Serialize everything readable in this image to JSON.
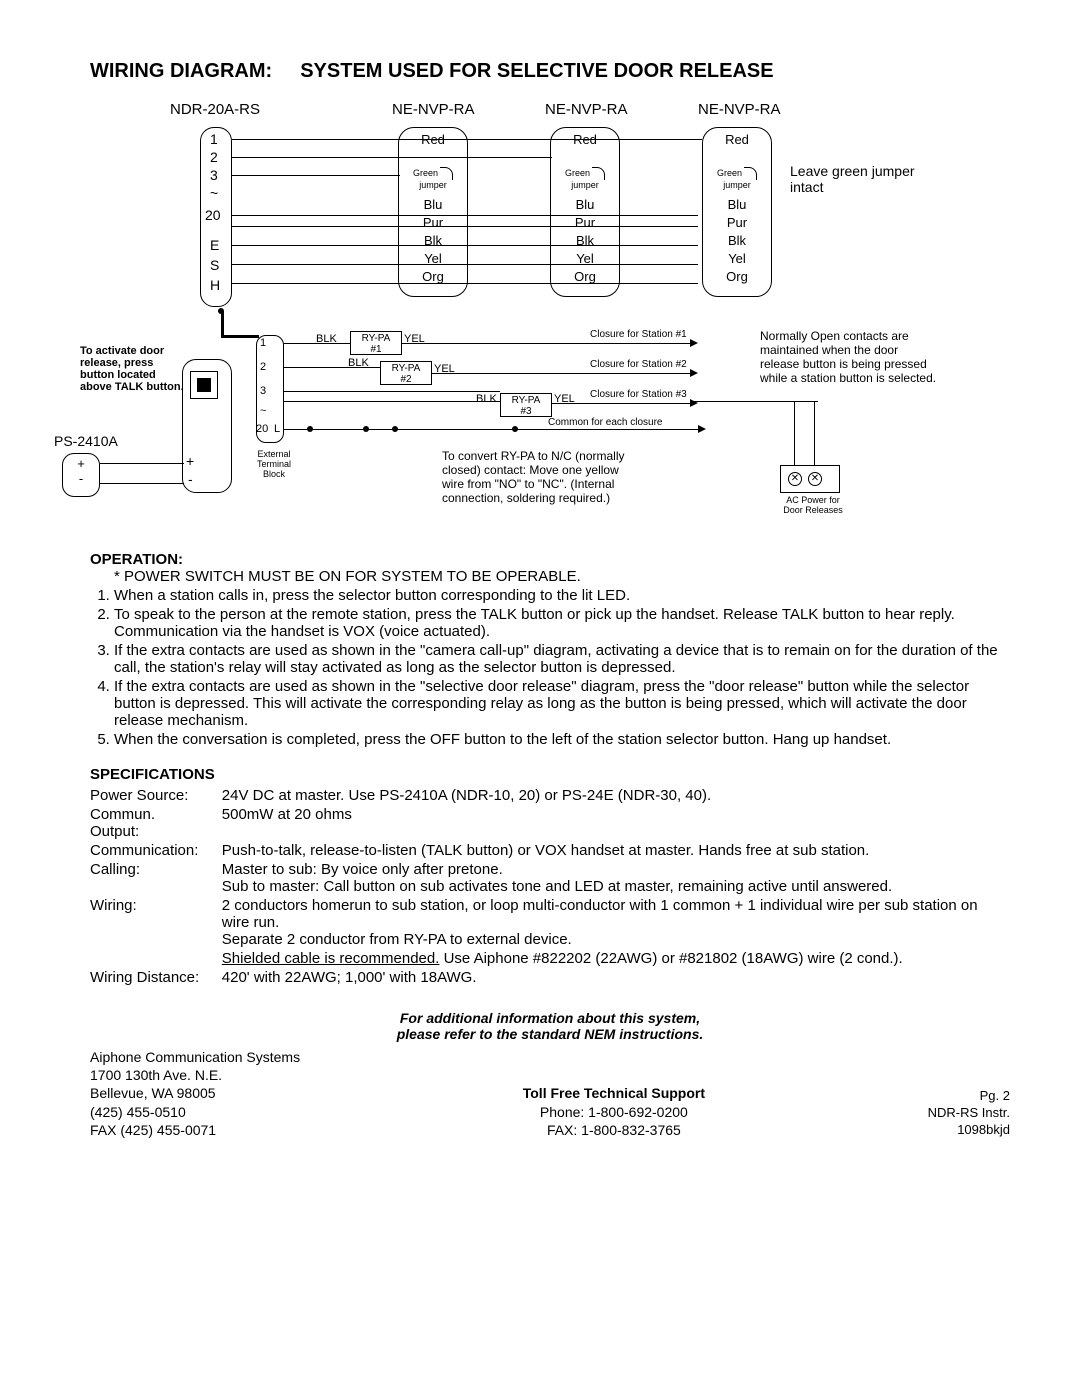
{
  "title_a": "WIRING DIAGRAM:",
  "title_b": "SYSTEM USED FOR SELECTIVE DOOR RELEASE",
  "diagram": {
    "ndr": "NDR-20A-RS",
    "nvp": "NE-NVP-RA",
    "terminals": [
      "1",
      "2",
      "3",
      "~",
      "20",
      "",
      "E",
      "S",
      "H"
    ],
    "nvp_rows": [
      "Red",
      "",
      "",
      "Blu",
      "Pur",
      "Blk",
      "Yel",
      "Org"
    ],
    "green": "Green",
    "jumper": "jumper",
    "leave": "Leave green jumper intact",
    "activate": "To activate door release, press button located above TALK button.",
    "ps": "PS-2410A",
    "plus": "+",
    "minus": "-",
    "tb": [
      "1",
      "2",
      "3",
      "~",
      "20"
    ],
    "tbL": "L",
    "ext": "External Terminal Block",
    "convert": "To convert RY-PA to N/C (normally closed) contact: Move one yellow wire from \"NO\" to \"NC\".  (Internal connection, soldering required.)",
    "blk": "BLK",
    "yel": "YEL",
    "rypa": "RY-PA",
    "r1": "#1",
    "r2": "#2",
    "r3": "#3",
    "cl1": "Closure for Station #1",
    "cl2": "Closure for Station #2",
    "cl3": "Closure for Station #3",
    "common": "Common for each closure",
    "no_contacts": "Normally Open contacts are maintained when the door release button is being pressed while a station button is selected.",
    "acpower": "AC Power for Door Releases"
  },
  "operation": {
    "heading": "OPERATION:",
    "star": "* POWER SWITCH MUST BE ON FOR SYSTEM TO BE OPERABLE.",
    "items": [
      "When a station calls in, press the selector button corresponding to the lit LED.",
      "To speak to the person at the remote station, press the TALK button or pick up the handset.  Release TALK button to hear reply.  Communication via the handset is VOX (voice actuated).",
      "If the extra contacts are used as shown in the \"camera call-up\" diagram, activating a device that is to remain on for the duration of the call, the station's relay will stay activated as long as the selector button is depressed.",
      "If the extra contacts are used as shown in the \"selective door release\" diagram, press the \"door release\" button while the selector button is depressed.  This will activate the corresponding relay as long as the button is being pressed, which will activate the door release mechanism.",
      "When the conversation is completed, press the OFF button to the left of the station selector button. Hang up handset."
    ]
  },
  "spec": {
    "heading": "SPECIFICATIONS",
    "rows": [
      {
        "k": "Power Source:",
        "v": "24V DC at master.  Use PS-2410A (NDR-10, 20) or PS-24E (NDR-30, 40)."
      },
      {
        "k": "Commun. Output:",
        "v": "500mW at 20 ohms"
      },
      {
        "k": "Communication:",
        "v": "Push-to-talk, release-to-listen (TALK button) or VOX handset at master. Hands free at sub station."
      },
      {
        "k": "Calling:",
        "v": "Master to sub:  By voice only after pretone.\nSub to master:  Call button on sub activates tone and LED at master, remaining active until answered."
      },
      {
        "k": "Wiring:",
        "v": "2 conductors homerun to sub station, or loop multi-conductor with 1 common + 1 individual wire per sub station on wire run.\nSeparate 2 conductor from RY-PA to external device."
      },
      {
        "k": "",
        "v_u": "Shielded cable is recommended.",
        "v2": "  Use Aiphone #822202 (22AWG) or #821802 (18AWG) wire (2 cond.)."
      },
      {
        "k": "Wiring Distance:",
        "v": "420' with 22AWG; 1,000' with 18AWG."
      }
    ]
  },
  "footer": {
    "info1": "For additional information about this system,",
    "info2": "please refer to the standard NEM instructions.",
    "toll": "Toll Free Technical Support",
    "phone": "Phone: 1-800-692-0200",
    "fax": "FAX: 1-800-832-3765",
    "addr": [
      "Aiphone Communication Systems",
      "1700 130th Ave. N.E.",
      "Bellevue, WA  98005",
      "(425) 455-0510",
      "FAX (425) 455-0071"
    ],
    "right": [
      "Pg. 2",
      "NDR-RS Instr.",
      "1098bkjd"
    ]
  }
}
